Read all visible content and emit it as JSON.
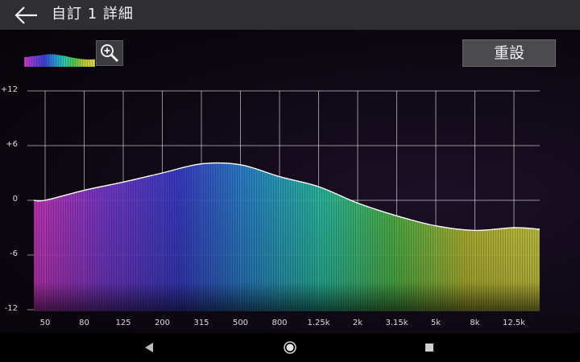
{
  "header": {
    "title": "自訂 1 詳細",
    "back_icon": "arrow-left-icon"
  },
  "toolbar": {
    "reset_label": "重設",
    "zoom_icon": "zoom-in-icon"
  },
  "chart_data": {
    "type": "area",
    "title": "",
    "xlabel": "",
    "ylabel": "",
    "y_ticks": [
      "+12",
      "+6",
      "0",
      "-6",
      "-12"
    ],
    "ylim": [
      -12,
      12
    ],
    "categories": [
      "50",
      "80",
      "125",
      "200",
      "315",
      "500",
      "800",
      "1.25k",
      "2k",
      "3.15k",
      "5k",
      "8k",
      "12.5k"
    ],
    "values": [
      0.0,
      1.1,
      2.0,
      3.0,
      4.0,
      3.9,
      2.6,
      1.5,
      -0.3,
      -1.7,
      -2.8,
      -3.3,
      -3.0
    ],
    "grid": true,
    "colors": [
      "#d038c6",
      "#7a3cd6",
      "#3b3fd0",
      "#2a8fd2",
      "#2cc7a6",
      "#54c24a",
      "#c3c534",
      "#d8d845"
    ]
  },
  "navbar": {
    "back_icon": "triangle-back-icon",
    "home_icon": "circle-home-icon",
    "recents_icon": "square-recents-icon"
  }
}
